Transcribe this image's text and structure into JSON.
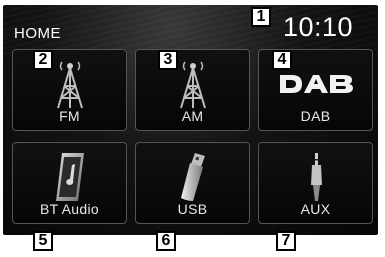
{
  "header": {
    "title": "HOME",
    "clock": "10:10"
  },
  "tiles": [
    {
      "label": "FM",
      "icon": "radio-tower-icon"
    },
    {
      "label": "AM",
      "icon": "radio-tower-icon"
    },
    {
      "label": "DAB",
      "icon": "dab-logo-icon"
    },
    {
      "label": "BT Audio",
      "icon": "music-player-icon"
    },
    {
      "label": "USB",
      "icon": "usb-drive-icon"
    },
    {
      "label": "AUX",
      "icon": "aux-cable-icon"
    }
  ],
  "callouts": [
    "1",
    "2",
    "3",
    "4",
    "5",
    "6",
    "7"
  ],
  "colors": {
    "background": "#0a0a0a",
    "tile_border": "#555555",
    "text": "#ffffff"
  }
}
